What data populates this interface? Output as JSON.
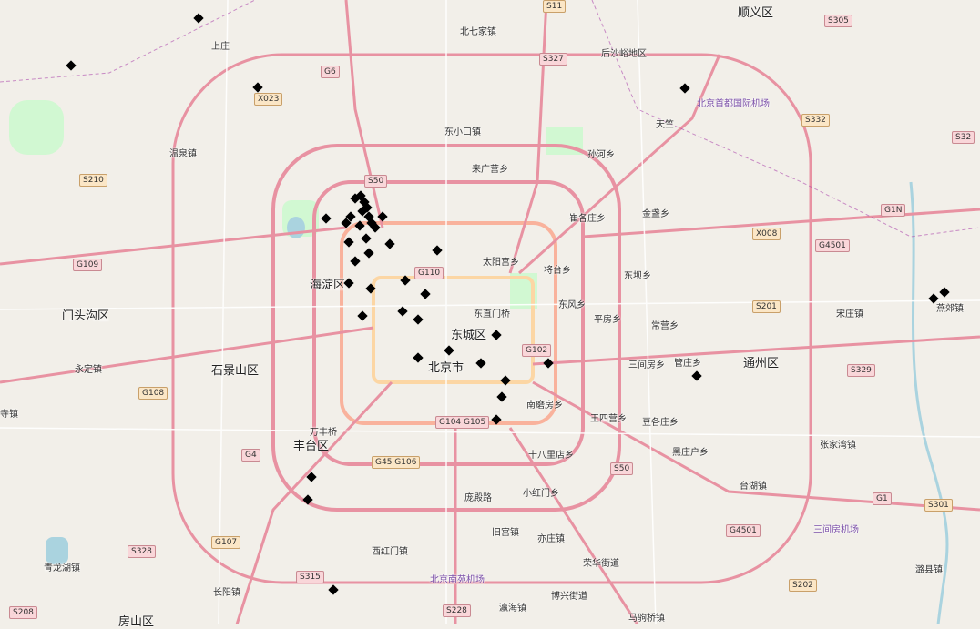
{
  "map": {
    "city": "北京市",
    "colors": {
      "background": "#f2efe9",
      "motorway": "#e892a2",
      "trunk": "#f9b29c",
      "primary": "#fcd6a4",
      "park": "#c8facc",
      "water": "#aad3df",
      "marker": "#000000",
      "boundary": "#ac46ac"
    },
    "marker_icon": "diamond-icon",
    "district_labels": [
      "海淀区",
      "东城区",
      "北京市",
      "石景山区",
      "丰台区",
      "门头沟区",
      "通州区",
      "顺义区",
      "房山区"
    ],
    "place_labels": [
      "上庄",
      "温泉镇",
      "东小口镇",
      "北七家镇",
      "后沙峪地区",
      "天竺",
      "孙河乡",
      "东风乡",
      "来广营乡",
      "崔各庄乡",
      "金盏乡",
      "太阳宫乡",
      "将台乡",
      "东坝乡",
      "平房乡",
      "常营乡",
      "东直门桥",
      "三间房乡",
      "管庄乡",
      "南磨房乡",
      "王四营乡",
      "豆各庄乡",
      "十八里店乡",
      "黑庄户乡",
      "张家湾镇",
      "台湖镇",
      "永定镇",
      "寺镇",
      "万丰桥",
      "小红门乡",
      "旧宫镇",
      "亦庄镇",
      "荣华街道",
      "西红门镇",
      "长阳镇",
      "青龙湖镇",
      "博兴街道",
      "马驹桥镇",
      "瀛海镇",
      "宋庄镇",
      "燕郊镇",
      "潞县镇",
      "庞殿路"
    ],
    "airport_labels": [
      "北京首都国际机场",
      "北京南苑机场",
      "三间房机场"
    ],
    "route_shields": [
      "S11",
      "S305",
      "S327",
      "X023",
      "G6",
      "S50",
      "S210",
      "G109",
      "G110",
      "X008",
      "G1N",
      "G4501",
      "S201",
      "G102",
      "S329",
      "G108",
      "G104 G105",
      "G4",
      "G45 G106",
      "S50",
      "G1",
      "S301",
      "G4501",
      "S328",
      "G107",
      "S315",
      "S228",
      "S202",
      "S208",
      "S32",
      "S332"
    ]
  }
}
